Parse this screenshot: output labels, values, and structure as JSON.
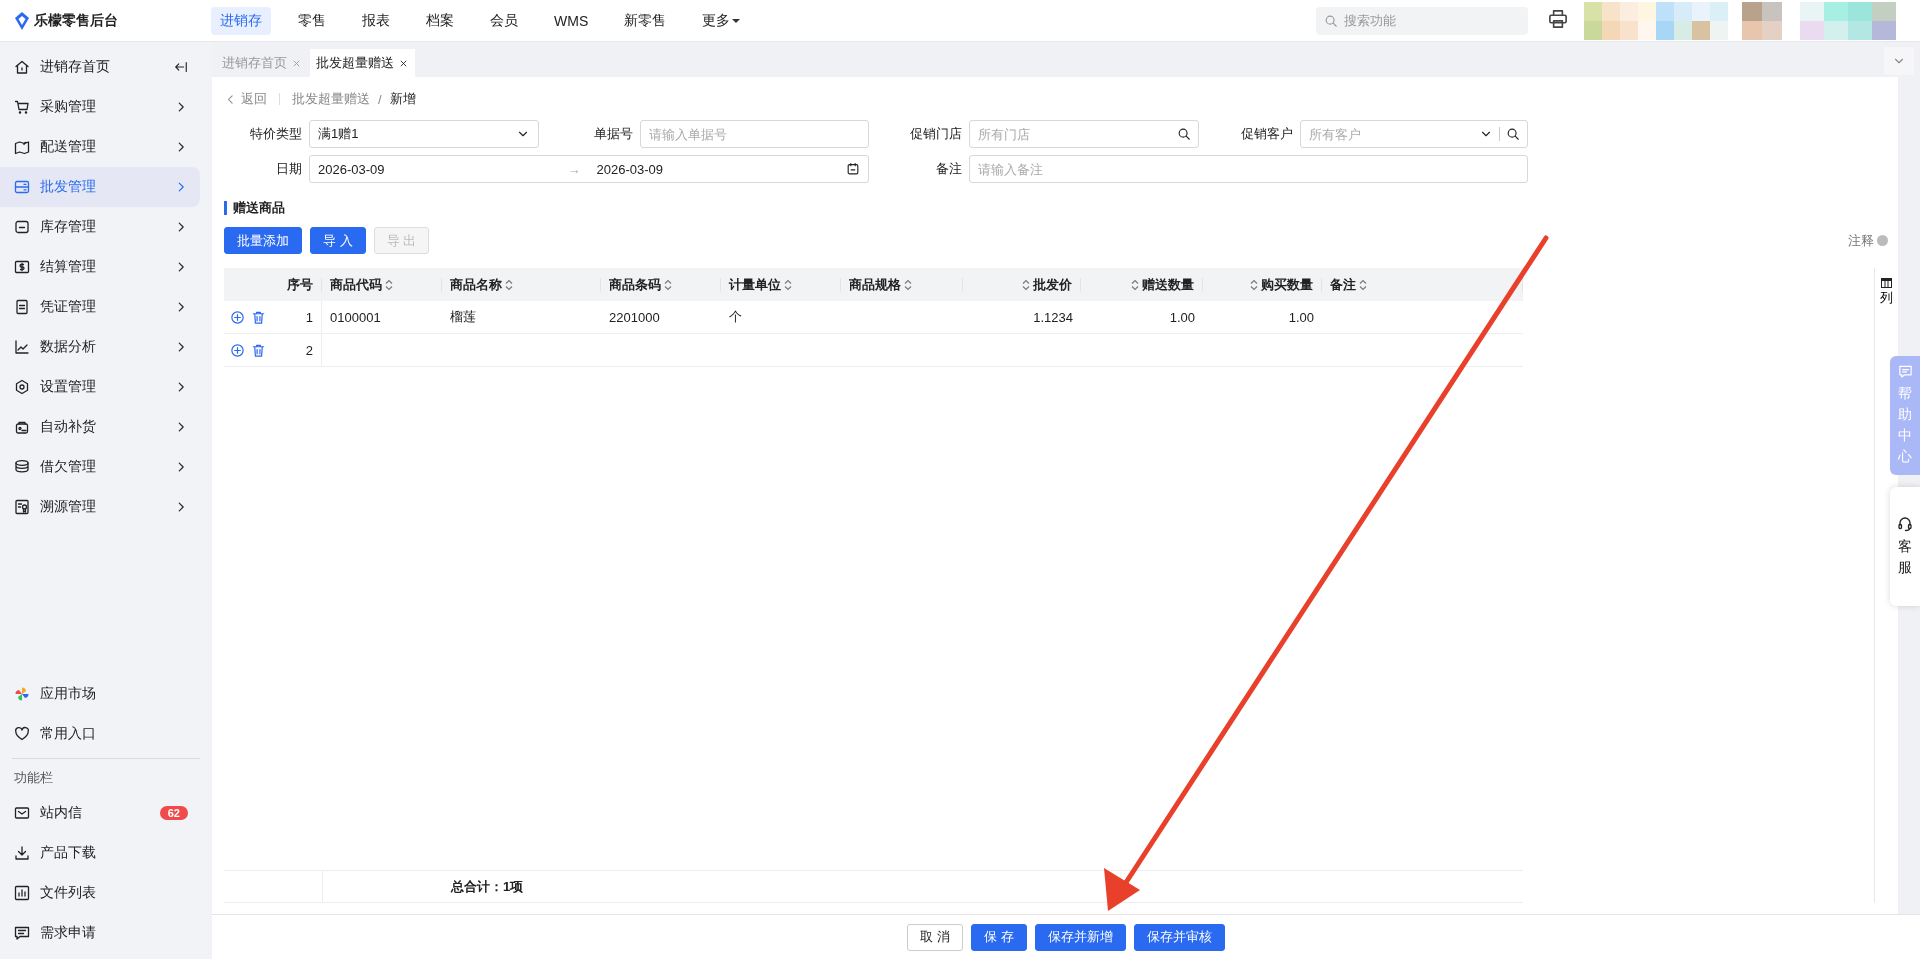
{
  "app": {
    "title": "乐檬零售后台"
  },
  "top_nav": [
    {
      "label": "进销存",
      "selected": true
    },
    {
      "label": "零售",
      "selected": false
    },
    {
      "label": "报表",
      "selected": false
    },
    {
      "label": "档案",
      "selected": false
    },
    {
      "label": "会员",
      "selected": false
    },
    {
      "label": "WMS",
      "selected": false
    },
    {
      "label": "新零售",
      "selected": false
    },
    {
      "label": "更多",
      "selected": false
    }
  ],
  "search": {
    "placeholder": "搜索功能"
  },
  "sidebar": {
    "items": [
      {
        "label": "进销存首页",
        "selected": false
      },
      {
        "label": "采购管理",
        "selected": false
      },
      {
        "label": "配送管理",
        "selected": false
      },
      {
        "label": "批发管理",
        "selected": true
      },
      {
        "label": "库存管理",
        "selected": false
      },
      {
        "label": "结算管理",
        "selected": false
      },
      {
        "label": "凭证管理",
        "selected": false
      },
      {
        "label": "数据分析",
        "selected": false
      },
      {
        "label": "设置管理",
        "selected": false
      },
      {
        "label": "自动补货",
        "selected": false
      },
      {
        "label": "借欠管理",
        "selected": false
      },
      {
        "label": "溯源管理",
        "selected": false
      }
    ],
    "shortcuts": [
      {
        "label": "应用市场"
      },
      {
        "label": "常用入口"
      }
    ],
    "section_title": "功能栏",
    "tools": [
      {
        "label": "站内信",
        "badge": "62"
      },
      {
        "label": "产品下载"
      },
      {
        "label": "文件列表"
      },
      {
        "label": "需求申请"
      }
    ]
  },
  "tabs": [
    {
      "label": "进销存首页",
      "selected": false
    },
    {
      "label": "批发超量赠送",
      "selected": true
    }
  ],
  "breadcrumb": {
    "back": "返回",
    "items": [
      "批发超量赠送",
      "新增"
    ],
    "separator": "/"
  },
  "filters": [
    {
      "label": "特价类型",
      "kind": "select",
      "value": "满1赠1",
      "wide": false
    },
    {
      "label": "单据号",
      "kind": "text",
      "placeholder": "请输入单据号",
      "wide": false
    },
    {
      "label": "促销门店",
      "kind": "search",
      "placeholder": "所有门店",
      "wide": false
    },
    {
      "label": "促销客户",
      "kind": "select_search",
      "placeholder": "所有客户",
      "wide": false
    },
    {
      "label": "日期",
      "kind": "date_range",
      "start": "2026-03-09",
      "range_separator": "→",
      "end": "2026-03-09",
      "wide": true
    },
    {
      "label": "备注",
      "kind": "text",
      "placeholder": "请输入备注",
      "wide": true
    }
  ],
  "section": {
    "title": "赠送商品"
  },
  "toolbar": [
    {
      "label": "批量添加",
      "disabled": false
    },
    {
      "label": "导 入",
      "disabled": false
    },
    {
      "label": "导 出",
      "disabled": true
    }
  ],
  "note": "注释",
  "table": {
    "columns": [
      {
        "label": "序号",
        "sortable": false
      },
      {
        "label": "商品代码",
        "sortable": true
      },
      {
        "label": "商品名称",
        "sortable": true
      },
      {
        "label": "商品条码",
        "sortable": true
      },
      {
        "label": "计量单位",
        "sortable": true
      },
      {
        "label": "商品规格",
        "sortable": true
      },
      {
        "label": "批发价",
        "sortable": true
      },
      {
        "label": "赠送数量",
        "sortable": true
      },
      {
        "label": "购买数量",
        "sortable": true
      },
      {
        "label": "备注",
        "sortable": true
      }
    ],
    "rows": [
      {
        "index": "1",
        "product_code": "0100001",
        "product_name": "榴莲",
        "barcode": "2201000",
        "unit": "个",
        "wholesale_price": "1.1234",
        "gift_qty": "1.00",
        "purchase_qty": "1.00"
      },
      {
        "index": "2"
      }
    ],
    "footer": "总合计：1项",
    "column_setting": "列"
  },
  "help": {
    "label": "帮助中心"
  },
  "support": {
    "label": "客服"
  },
  "actions": [
    {
      "label": "取 消",
      "kind": "secondary"
    },
    {
      "label": "保 存",
      "kind": "primary"
    },
    {
      "label": "保存并新增",
      "kind": "primary"
    },
    {
      "label": "保存并审核",
      "kind": "primary"
    }
  ]
}
